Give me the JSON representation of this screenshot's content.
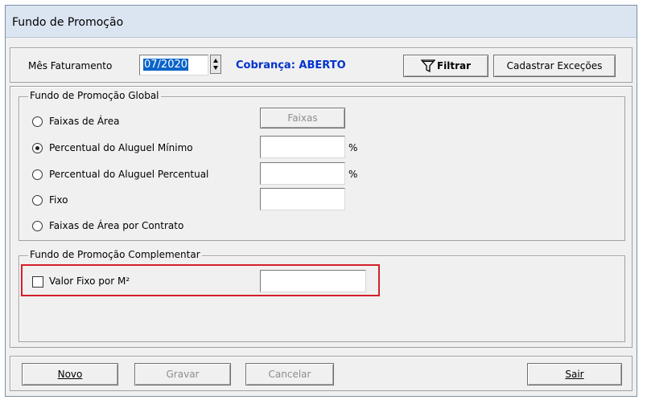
{
  "window": {
    "title": "Fundo de Promoção"
  },
  "header": {
    "mes_label": "Mês Faturamento",
    "mes_value": "07/2020",
    "cobranca_label": "Cobrança: ABERTO",
    "filtrar_label": "Filtrar",
    "cadastrar_label": "Cadastrar Exceções"
  },
  "global": {
    "legend": "Fundo de Promoção Global",
    "options": [
      {
        "label": "Faixas de Área",
        "selected": false
      },
      {
        "label": "Percentual do Aluguel Mínimo",
        "selected": true
      },
      {
        "label": "Percentual do Aluguel Percentual",
        "selected": false
      },
      {
        "label": "Fixo",
        "selected": false
      },
      {
        "label": "Faixas de Área por Contrato",
        "selected": false
      }
    ],
    "faixas_button": "Faixas",
    "percent_symbol": "%",
    "minimo_value": "",
    "percentual_value": "",
    "fixo_value": ""
  },
  "complementar": {
    "legend": "Fundo de Promoção Complementar",
    "checkbox_label": "Valor Fixo por M²",
    "checked": false,
    "value": ""
  },
  "footer": {
    "novo": "Novo",
    "gravar": "Gravar",
    "cancelar": "Cancelar",
    "sair": "Sair"
  },
  "colors": {
    "accent": "#0033cc",
    "highlight": "#d4202a",
    "selection": "#0a64c8"
  }
}
